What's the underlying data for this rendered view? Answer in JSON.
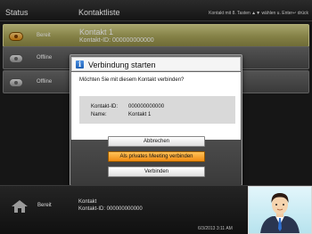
{
  "header": {
    "status_label": "Status",
    "list_label": "Kontaktliste",
    "hint": "Kontakt mit 8. Tasten ▲▼ wählen u. Enter↵ drück"
  },
  "contacts": [
    {
      "status": "Bereit",
      "name": "Kontakt 1",
      "id": "Kontakt-ID: 000000000000",
      "selected": true
    },
    {
      "status": "Offline",
      "name": "",
      "id": "",
      "selected": false
    },
    {
      "status": "Offline",
      "name": "",
      "id": "",
      "selected": false
    }
  ],
  "dialog": {
    "title": "Verbindung starten",
    "question": "Möchten Sie mit diesem Kontakt verbinden?",
    "id_label": "Kontakt-ID:",
    "id_value": "000000000000",
    "name_label": "Name:",
    "name_value": "Kontakt 1",
    "buttons": {
      "cancel": "Abbrechen",
      "private": "Als privates Meeting verbinden",
      "connect": "Verbinden"
    }
  },
  "footer": {
    "status": "Bereit",
    "name": "Kontakt",
    "id": "Kontakt-ID: 000000000000",
    "datetime": "6/3/2013 3:11 AM"
  },
  "colors": {
    "selected_row": "#c9c47a",
    "primary_button": "#f5a020",
    "info_icon": "#2e73c9"
  },
  "icons": [
    "info-icon",
    "home-icon",
    "status-ready-icon",
    "status-offline-icon",
    "self-view-avatar"
  ]
}
